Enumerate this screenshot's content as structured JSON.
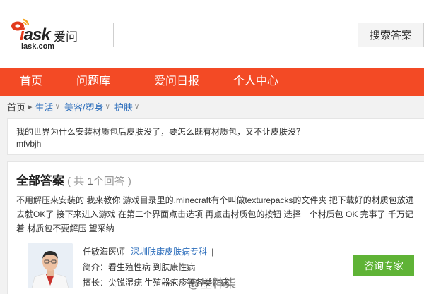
{
  "brand": {
    "logo_text_prefix": "i",
    "logo_text_main": "ask",
    "logo_cn": "爱问",
    "logo_domain": "iask.com",
    "accent_color": "#f34a25"
  },
  "search": {
    "value": "",
    "placeholder": "",
    "button_label": "搜索答案"
  },
  "nav": {
    "items": [
      "首页",
      "问题库",
      "爱问日报",
      "个人中心"
    ]
  },
  "breadcrumb": {
    "home": "首页",
    "sep": "▸",
    "items": [
      "生活",
      "美容/塑身",
      "护肤"
    ]
  },
  "question": {
    "title": "我的世界为什么安装材质包后皮肤没了，要怎么既有材质包，又不让皮肤没？",
    "user": "mfvbjh"
  },
  "answers": {
    "heading": "全部答案",
    "count_open": "( 共 ",
    "count_num": "1",
    "count_close": "个回答 )",
    "body": "不用解压来安装的  我来教你 游戏目录里的.minecraft有个叫做texturepacks的文件夹   把下载好的材质包放进去就OK了  接下来进入游戏  在第二个界面点击选项   再点击材质包的按钮   选择一个材质包    OK   完事了 千万记着  材质包不要解压   望采纳"
  },
  "expert": {
    "name": "任敏海医师",
    "org": "深圳肤康皮肤病专科",
    "bar": "|",
    "intro": "简介：看生殖性病 到肤康性病",
    "skill": "擅长：尖锐湿疣 生殖器疱疹等各类性病",
    "consult_label": "咨询专家",
    "consult_color": "#5fb336"
  },
  "watermark": "@星神柒"
}
